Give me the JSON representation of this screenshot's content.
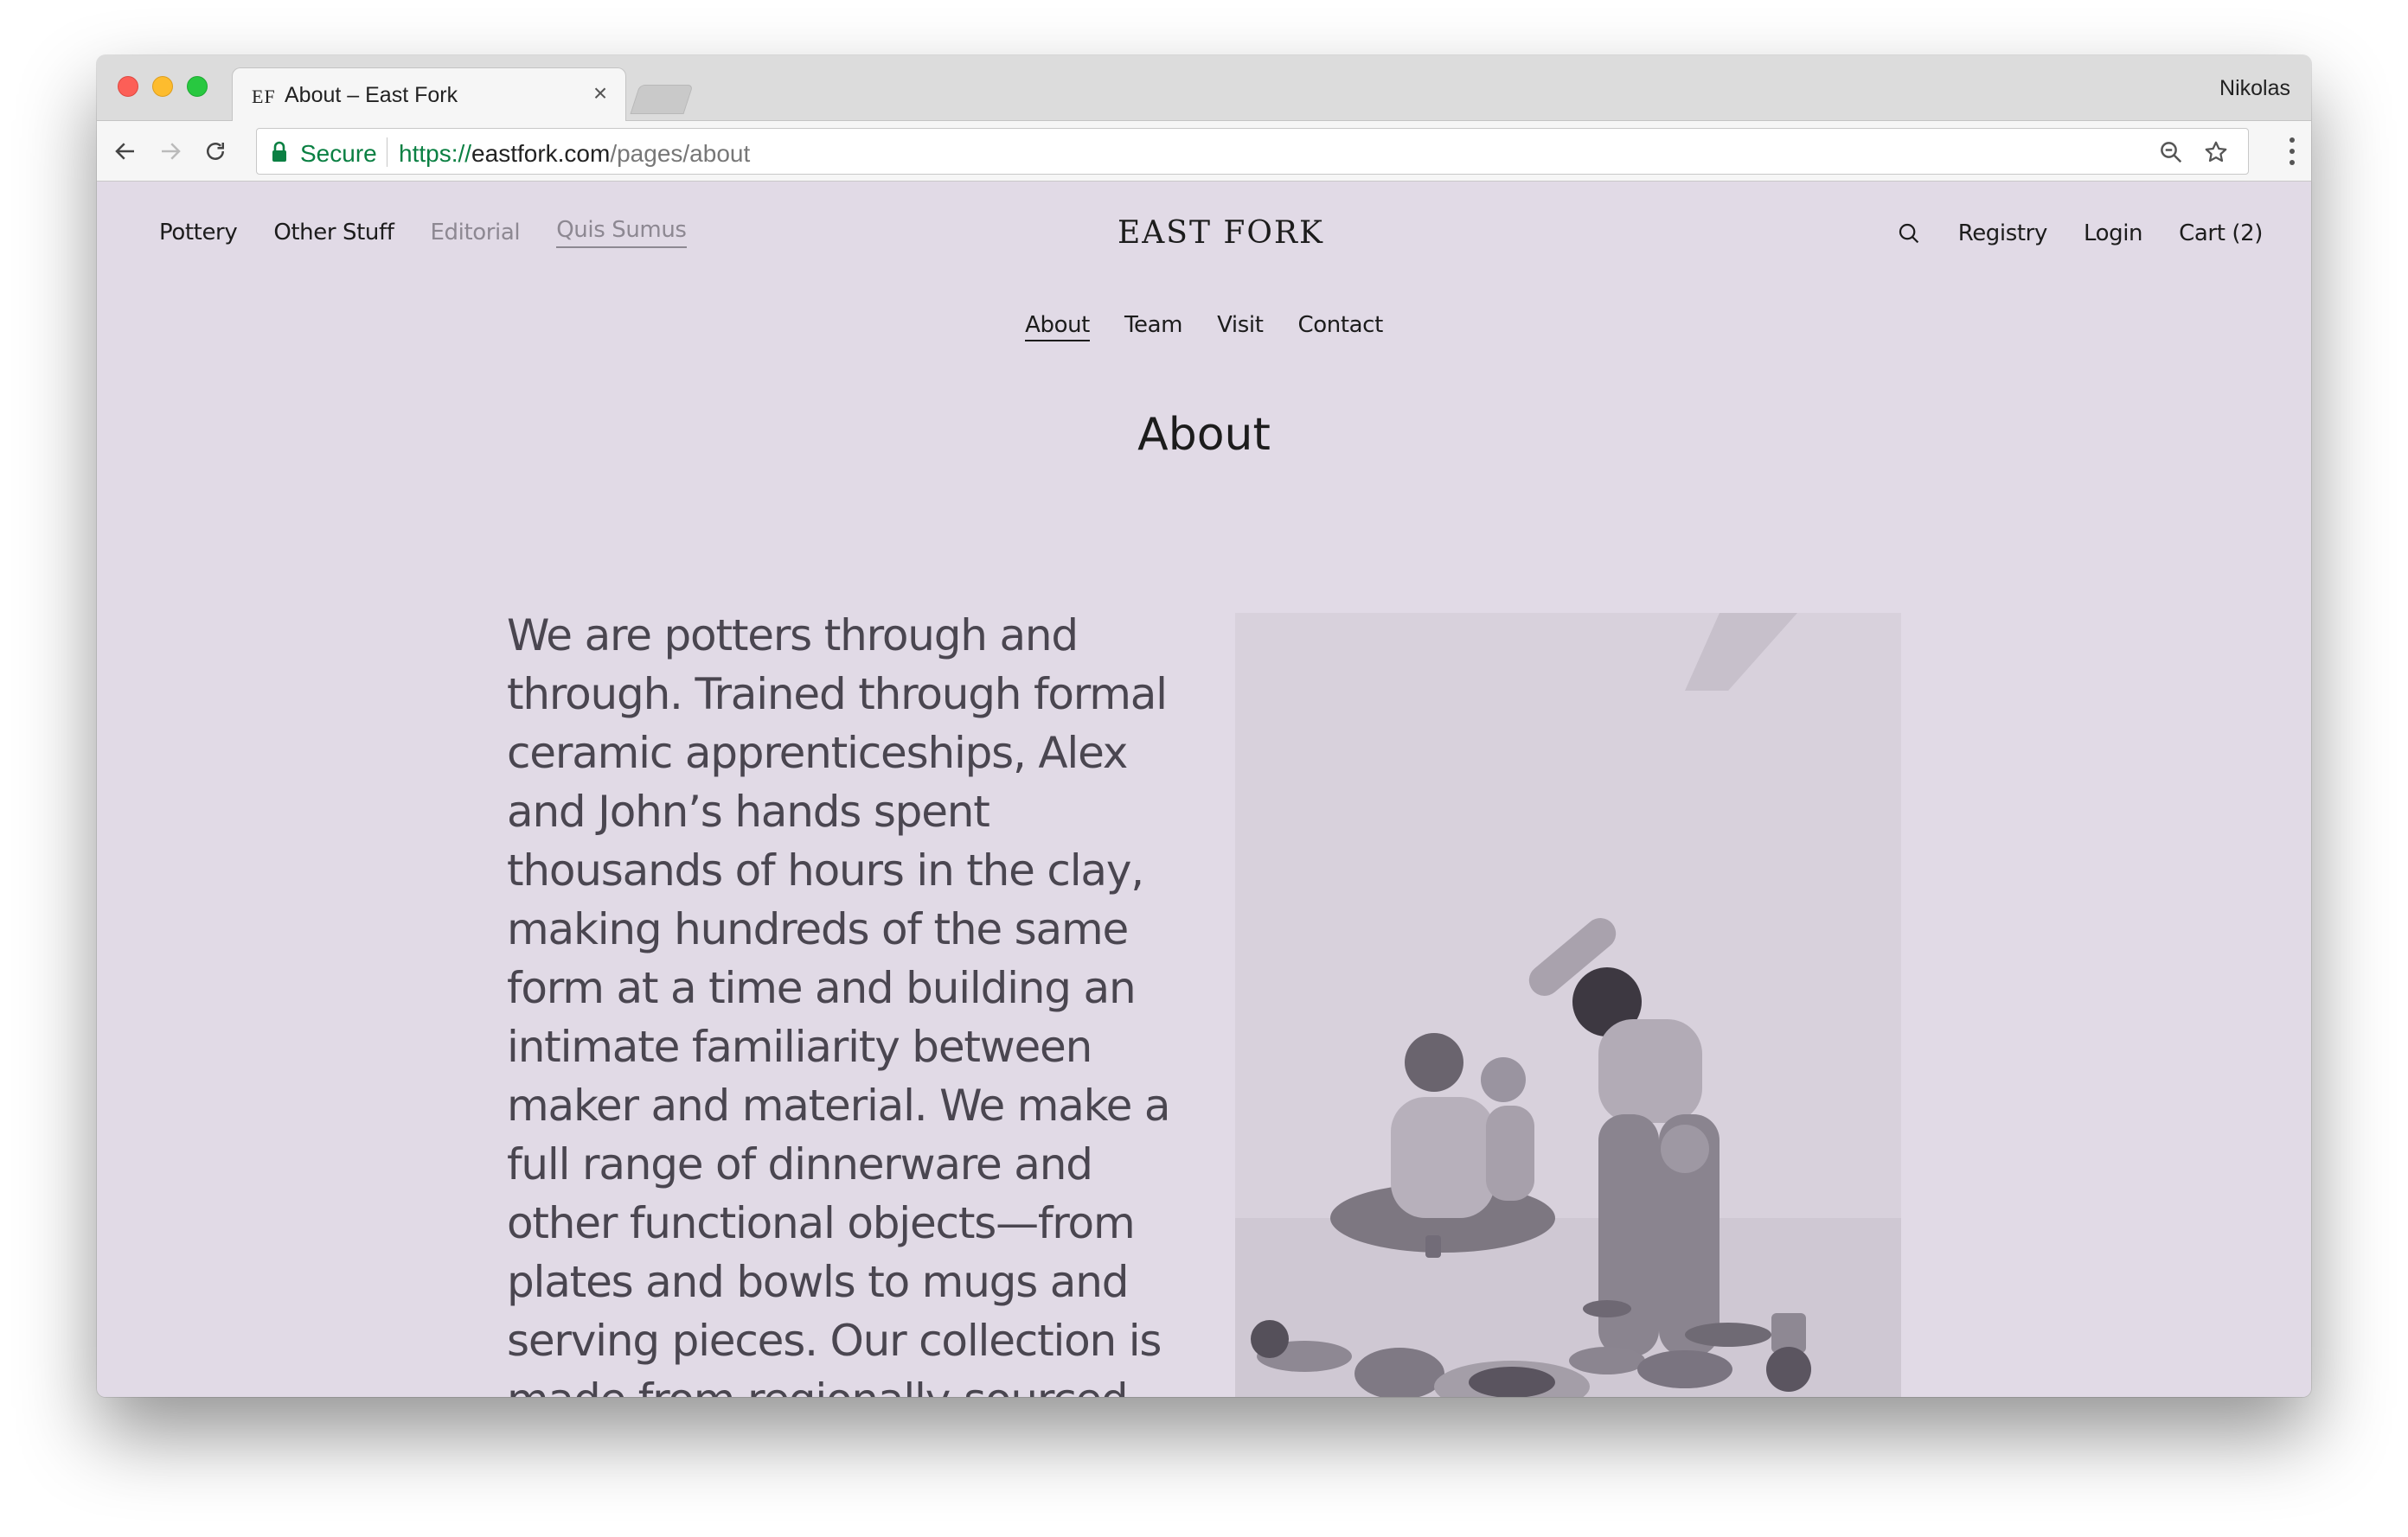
{
  "browser": {
    "tab_favicon": "EF",
    "tab_title": "About – East Fork",
    "tab_close": "×",
    "profile_name": "Nikolas",
    "secure_label": "Secure",
    "url_scheme": "https://",
    "url_host": "eastfork.com",
    "url_path": "/pages/about"
  },
  "site": {
    "logo": "EAST FORK",
    "nav_left": [
      {
        "label": "Pottery"
      },
      {
        "label": "Other Stuff"
      },
      {
        "label": "Editorial"
      },
      {
        "label": "Quis Sumus"
      }
    ],
    "nav_right": [
      {
        "label": "Registry"
      },
      {
        "label": "Login"
      },
      {
        "label": "Cart (2)"
      }
    ],
    "sub_nav": [
      {
        "label": "About"
      },
      {
        "label": "Team"
      },
      {
        "label": "Visit"
      },
      {
        "label": "Contact"
      }
    ],
    "page_title": "About",
    "intro_text": "We are potters through and through. Trained through formal ceramic apprenticeships, Alex and John’s hands spent thousands of hours in the clay, making hundreds of the same form at a time and building an intimate familiarity between maker and material. We make a full range of dinnerware and other functional objects—from plates and bowls to mugs and serving pieces. Our collection is made from regionally-sourced stoneware clay and fired in a gas"
  },
  "colors": {
    "page_background": "#e1dae6",
    "secure_green": "#0b8043",
    "muted_nav": "#8d8892",
    "body_text": "#4a4650"
  },
  "icons": {
    "back": "arrow-left-icon",
    "forward": "arrow-right-icon",
    "reload": "reload-icon",
    "lock": "lock-icon",
    "zoom": "zoom-icon",
    "bookmark": "star-icon",
    "menu": "kebab-menu-icon",
    "search": "search-icon"
  }
}
